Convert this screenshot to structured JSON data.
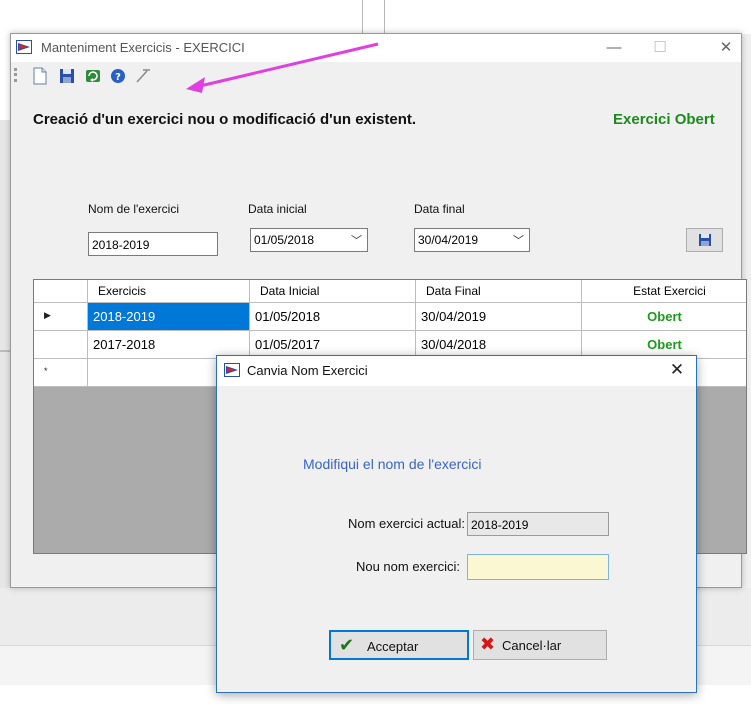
{
  "main_window": {
    "title": "Manteniment Exercicis - EXERCICI",
    "controls": {
      "minimize": "—",
      "maximize": "☐",
      "close": "✕"
    },
    "toolbar_icons": [
      "new-document-icon",
      "save-icon",
      "refresh-icon",
      "help-icon",
      "pin-icon"
    ]
  },
  "form": {
    "heading": "Creació d'un exercici nou o modificació d'un existent.",
    "status": "Exercici Obert",
    "status_color": "#1e8a1e",
    "name_label": "Nom de l'exercici",
    "name_value": "2018-2019",
    "start_label": "Data inicial",
    "start_value": "01/05/2018",
    "end_label": "Data final",
    "end_value": "30/04/2019"
  },
  "grid": {
    "columns": [
      "Exercicis",
      "Data Inicial",
      "Data Final",
      "Estat Exercici"
    ],
    "rows": [
      {
        "marker": "▶",
        "exercici": "2018-2019",
        "inicial": "01/05/2018",
        "final": "30/04/2019",
        "estat": "Obert",
        "selected": true
      },
      {
        "marker": "",
        "exercici": "2017-2018",
        "inicial": "01/05/2017",
        "final": "30/04/2018",
        "estat": "Obert",
        "selected": false
      }
    ],
    "new_row_marker": "*",
    "selection_color": "#0078d7"
  },
  "dialog": {
    "title": "Canvia Nom Exercici",
    "close": "✕",
    "message": "Modifiqui el nom de l'exercici",
    "current_label": "Nom exercici actual:",
    "current_value": "2018-2019",
    "new_label": "Nou nom exercici:",
    "new_value": "",
    "ok_label": "Acceptar",
    "ok_icon": "✔",
    "cancel_label": "Cancel·lar",
    "cancel_icon": "✖"
  },
  "annotation": {
    "arrow_color": "#e040e0"
  }
}
